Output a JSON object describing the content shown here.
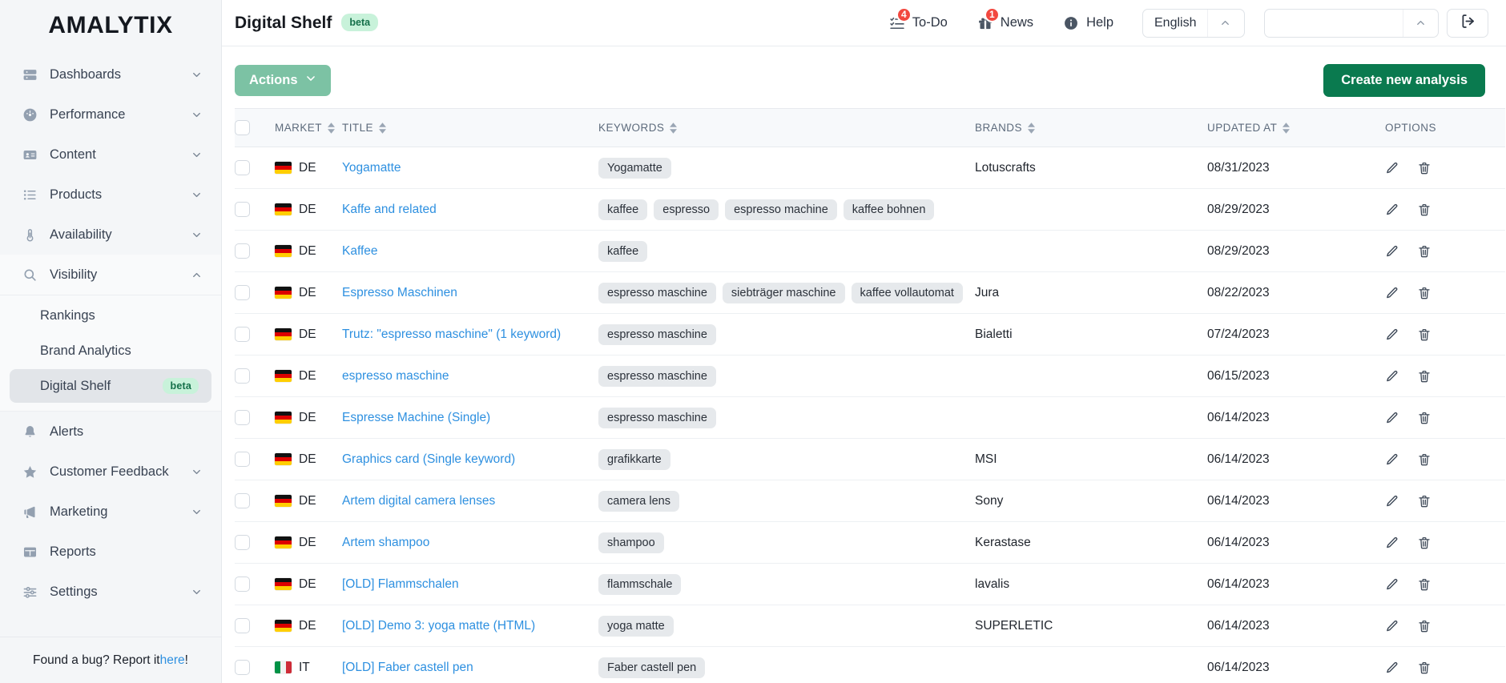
{
  "sidebar": {
    "brand": "AMALYTIX",
    "items": [
      {
        "label": "Dashboards",
        "icon": "server-icon",
        "expandable": true,
        "state": "collapsed"
      },
      {
        "label": "Performance",
        "icon": "gauge-icon",
        "expandable": true,
        "state": "collapsed"
      },
      {
        "label": "Content",
        "icon": "id-card-icon",
        "expandable": true,
        "state": "collapsed"
      },
      {
        "label": "Products",
        "icon": "list-icon",
        "expandable": true,
        "state": "collapsed"
      },
      {
        "label": "Availability",
        "icon": "thermometer-icon",
        "expandable": true,
        "state": "collapsed"
      },
      {
        "label": "Visibility",
        "icon": "search-icon",
        "expandable": true,
        "state": "expanded"
      }
    ],
    "visibility_subitems": [
      {
        "label": "Rankings",
        "active": false,
        "badge": ""
      },
      {
        "label": "Brand Analytics",
        "active": false,
        "badge": ""
      },
      {
        "label": "Digital Shelf",
        "active": true,
        "badge": "beta"
      }
    ],
    "items_bottom": [
      {
        "label": "Alerts",
        "icon": "bell-icon",
        "expandable": false
      },
      {
        "label": "Customer Feedback",
        "icon": "star-icon",
        "expandable": true
      },
      {
        "label": "Marketing",
        "icon": "megaphone-icon",
        "expandable": true
      },
      {
        "label": "Reports",
        "icon": "table-icon",
        "expandable": false
      },
      {
        "label": "Settings",
        "icon": "sliders-icon",
        "expandable": true
      }
    ],
    "footer": {
      "prefix": "Found a bug? Report it ",
      "link": "here",
      "suffix": "!"
    }
  },
  "header": {
    "title": "Digital Shelf",
    "title_badge": "beta",
    "todo": {
      "label": "To-Do",
      "count": "4",
      "icon": "checklist-icon"
    },
    "news": {
      "label": "News",
      "count": "1",
      "icon": "gift-icon"
    },
    "help": {
      "label": "Help",
      "icon": "info-icon"
    },
    "language": {
      "value": "English",
      "caret": "chevron-up-icon"
    },
    "account": {
      "value": "",
      "placeholder": "",
      "caret": "chevron-up-icon"
    },
    "logout": {
      "icon": "logout-icon"
    }
  },
  "toolbar": {
    "actions_label": "Actions",
    "actions_caret": "chevron-down-icon",
    "create_label": "Create new analysis"
  },
  "table": {
    "columns": [
      {
        "key": "checkbox",
        "label": "",
        "sortable": false
      },
      {
        "key": "market",
        "label": "MARKET",
        "sortable": true
      },
      {
        "key": "title",
        "label": "TITLE",
        "sortable": true
      },
      {
        "key": "keywords",
        "label": "KEYWORDS",
        "sortable": true
      },
      {
        "key": "brands",
        "label": "BRANDS",
        "sortable": true
      },
      {
        "key": "updated",
        "label": "UPDATED AT",
        "sortable": true
      },
      {
        "key": "options",
        "label": "OPTIONS",
        "sortable": false
      }
    ],
    "rows": [
      {
        "market": "DE",
        "flag": "de",
        "title": "Yogamatte",
        "keywords": [
          "Yogamatte"
        ],
        "brands": "Lotuscrafts",
        "updated": "08/31/2023"
      },
      {
        "market": "DE",
        "flag": "de",
        "title": "Kaffe and related",
        "keywords": [
          "kaffee",
          "espresso",
          "espresso machine",
          "kaffee bohnen"
        ],
        "brands": "",
        "updated": "08/29/2023"
      },
      {
        "market": "DE",
        "flag": "de",
        "title": "Kaffee",
        "keywords": [
          "kaffee"
        ],
        "brands": "",
        "updated": "08/29/2023"
      },
      {
        "market": "DE",
        "flag": "de",
        "title": "Espresso Maschinen",
        "keywords": [
          "espresso maschine",
          "siebträger maschine",
          "kaffee vollautomat"
        ],
        "brands": "Jura",
        "updated": "08/22/2023"
      },
      {
        "market": "DE",
        "flag": "de",
        "title": "Trutz: \"espresso maschine\" (1 keyword)",
        "keywords": [
          "espresso maschine"
        ],
        "brands": "Bialetti",
        "updated": "07/24/2023"
      },
      {
        "market": "DE",
        "flag": "de",
        "title": "espresso maschine",
        "keywords": [
          "espresso maschine"
        ],
        "brands": "",
        "updated": "06/15/2023"
      },
      {
        "market": "DE",
        "flag": "de",
        "title": "Espresse Machine (Single)",
        "keywords": [
          "espresso maschine"
        ],
        "brands": "",
        "updated": "06/14/2023"
      },
      {
        "market": "DE",
        "flag": "de",
        "title": "Graphics card (Single keyword)",
        "keywords": [
          "grafikkarte"
        ],
        "brands": "MSI",
        "updated": "06/14/2023"
      },
      {
        "market": "DE",
        "flag": "de",
        "title": "Artem digital camera lenses",
        "keywords": [
          "camera lens"
        ],
        "brands": "Sony",
        "updated": "06/14/2023"
      },
      {
        "market": "DE",
        "flag": "de",
        "title": "Artem shampoo",
        "keywords": [
          "shampoo"
        ],
        "brands": "Kerastase",
        "updated": "06/14/2023"
      },
      {
        "market": "DE",
        "flag": "de",
        "title": "[OLD] Flammschalen",
        "keywords": [
          "flammschale"
        ],
        "brands": "lavalis",
        "updated": "06/14/2023"
      },
      {
        "market": "DE",
        "flag": "de",
        "title": "[OLD] Demo 3: yoga matte (HTML)",
        "keywords": [
          "yoga matte"
        ],
        "brands": "SUPERLETIC",
        "updated": "06/14/2023"
      },
      {
        "market": "IT",
        "flag": "it",
        "title": "[OLD] Faber castell pen",
        "keywords": [
          "Faber castell pen"
        ],
        "brands": "",
        "updated": "06/14/2023"
      }
    ],
    "row_actions": [
      {
        "name": "edit-icon",
        "title": "Edit"
      },
      {
        "name": "delete-icon",
        "title": "Delete"
      }
    ]
  },
  "colors": {
    "accent_green": "#0a7a4f",
    "actions_green": "#7cc2a4",
    "link_blue": "#2e90e0",
    "badge_red": "#f2483f",
    "beta_bg": "#c8f2da",
    "beta_text": "#15704a",
    "sidebar_bg": "#f4f6f8",
    "chip_bg": "#e6e9ec"
  }
}
